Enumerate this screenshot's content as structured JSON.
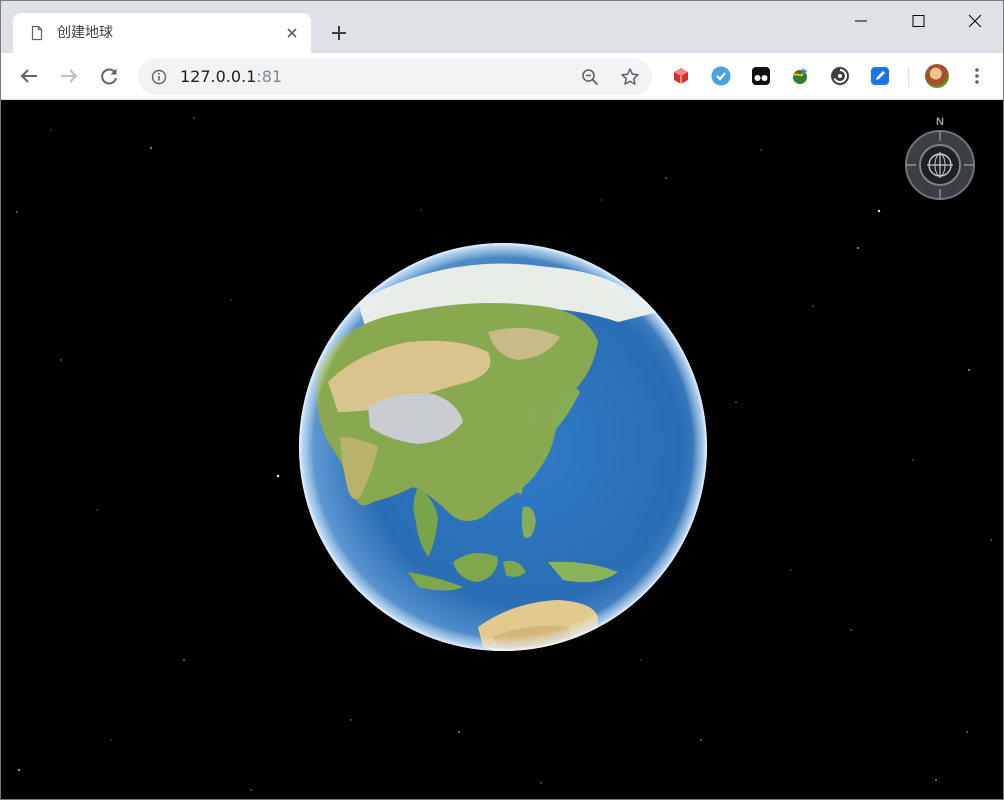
{
  "browser": {
    "tab": {
      "title": "创建地球",
      "favicon": "page-icon",
      "close": "close-icon"
    },
    "new_tab": "plus-icon",
    "window_controls": [
      "minimize-icon",
      "maximize-icon",
      "close-icon"
    ],
    "nav": [
      "back-arrow-icon",
      "forward-arrow-icon",
      "reload-icon"
    ],
    "address": {
      "security_icon": "info-icon",
      "host": "127.0.0.1",
      "port": ":81",
      "actions": [
        "zoom-out-icon",
        "star-icon"
      ]
    },
    "extensions": [
      {
        "name": "red-cube-extension-icon",
        "color": "#d93025"
      },
      {
        "name": "blue-check-extension-icon",
        "color": "#4aa3df"
      },
      {
        "name": "tampermonkey-extension-icon",
        "color": "#000000"
      },
      {
        "name": "green-globe-extension-icon",
        "color": "#2e7d32"
      },
      {
        "name": "dark-circle-extension-icon",
        "color": "#3c4043"
      },
      {
        "name": "blue-pen-extension-icon",
        "color": "#1a73e8"
      }
    ],
    "menu": "more-vert-icon"
  },
  "map": {
    "compass": {
      "north_label": "N"
    }
  },
  "colors": {
    "tabstrip_bg": "#dee1e6",
    "toolbar_bg": "#ffffff",
    "omnibox_bg": "#f1f3f4",
    "space_bg": "#000000",
    "ocean": "#2f6fb8",
    "land_green": "#7ea64a",
    "land_desert": "#d9c28f",
    "ice": "#eef0f2"
  }
}
